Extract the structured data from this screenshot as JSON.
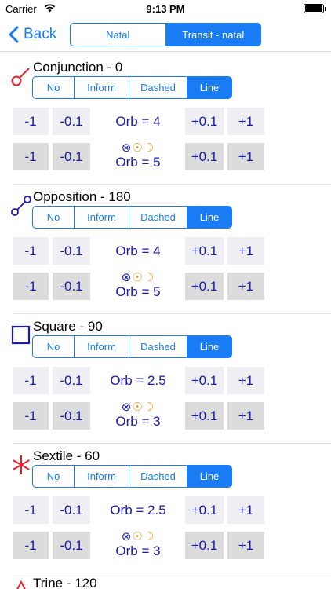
{
  "status": {
    "carrier": "Carrier",
    "time": "9:13 PM"
  },
  "nav": {
    "back_label": "Back",
    "segments": [
      "Natal",
      "Transit - natal"
    ],
    "selected": "Transit - natal"
  },
  "style_options": [
    "No",
    "Inform",
    "Dashed",
    "Line"
  ],
  "planet_symbols": [
    "⊗",
    "☉",
    "☽"
  ],
  "colors": {
    "accent": "#1a7cf5",
    "button_text": "#1a1aa8",
    "aspect_red": "#e0242a",
    "aspect_blue": "#1a1aa8",
    "planet_orange": "#e8901a"
  },
  "steps": {
    "minus1": "-1",
    "minus01": "-0.1",
    "plus01": "+0.1",
    "plus1": "+1"
  },
  "aspects": [
    {
      "title": "Conjunction - 0",
      "icon": "conjunction-icon",
      "selected": "Line",
      "orb": "Orb = 4",
      "orb_planets": "Orb = 5"
    },
    {
      "title": "Opposition - 180",
      "icon": "opposition-icon",
      "selected": "Line",
      "orb": "Orb = 4",
      "orb_planets": "Orb = 5"
    },
    {
      "title": "Square - 90",
      "icon": "square-icon",
      "selected": "Line",
      "orb": "Orb = 2.5",
      "orb_planets": "Orb = 3"
    },
    {
      "title": "Sextile - 60",
      "icon": "sextile-icon",
      "selected": "Line",
      "orb": "Orb = 2.5",
      "orb_planets": "Orb = 3"
    },
    {
      "title": "Trine - 120",
      "icon": "trine-icon"
    }
  ]
}
